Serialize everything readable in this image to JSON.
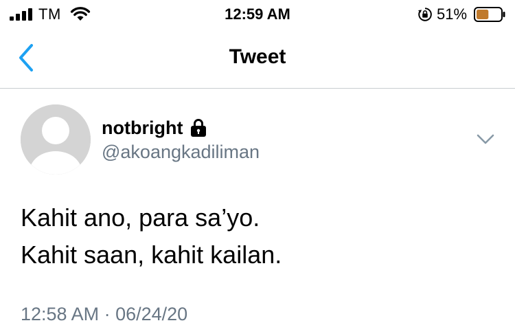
{
  "status_bar": {
    "carrier": "TM",
    "time": "12:59 AM",
    "battery_percent": "51%",
    "battery_level": 0.51,
    "battery_color": "#C07A2C",
    "icons": [
      "signal-icon",
      "wifi-icon",
      "rotation-lock-icon",
      "battery-icon"
    ]
  },
  "nav": {
    "title": "Tweet",
    "back_icon": "chevron-left-icon",
    "accent_color": "#1DA1F2"
  },
  "tweet": {
    "display_name": "notbright",
    "protected_icon": "lock-icon",
    "handle": "@akoangkadiliman",
    "text_lines": [
      "Kahit ano, para sa’yo.",
      "Kahit saan, kahit kailan."
    ],
    "timestamp": "12:58 AM · 06/24/20",
    "menu_icon": "chevron-down-icon",
    "avatar": "default-avatar"
  }
}
